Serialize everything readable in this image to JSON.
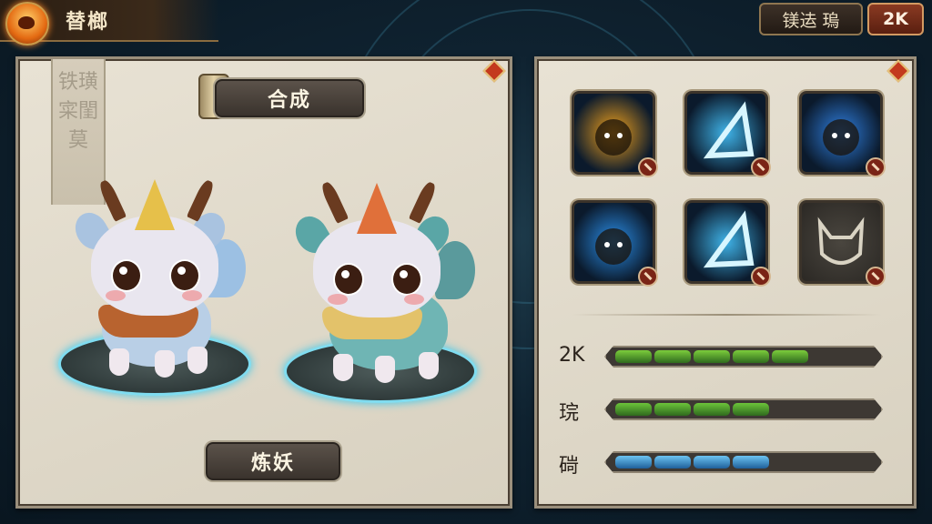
{
  "header": {
    "title": "替榔",
    "right_button": "镁迲 瑦",
    "level_badge": "2K"
  },
  "left_panel": {
    "banner_text": "铁璜寀閨莫",
    "compose_button": "合成",
    "refine_button": "炼妖",
    "creatures": [
      {
        "name": "blue-kirin",
        "body_color": "#b9cfe6",
        "mane_color": "#b8632f",
        "crest_color": "#e6c04a"
      },
      {
        "name": "teal-kirin",
        "body_color": "#6fb5b4",
        "mane_color": "#e3c26a",
        "crest_color": "#e0703a"
      }
    ]
  },
  "right_panel": {
    "skills": [
      {
        "icon": "fire-demon-icon",
        "color": "#f2a21c"
      },
      {
        "icon": "ice-shard-icon",
        "color": "#3fb3e8"
      },
      {
        "icon": "water-spirit-icon",
        "color": "#2f7fe0"
      },
      {
        "icon": "ghost-spirit-icon",
        "color": "#2a8ee8"
      },
      {
        "icon": "frost-blade-icon",
        "color": "#3fb3e8"
      },
      {
        "icon": "locked-beast-icon",
        "color": "#5a554d"
      }
    ],
    "stats": [
      {
        "label": "2K",
        "filled": 5,
        "total": 7,
        "color": "#7ccd3c"
      },
      {
        "label": "琓",
        "filled": 4,
        "total": 7,
        "color": "#6cc43a"
      },
      {
        "label": "碋",
        "filled": 4,
        "total": 7,
        "color": "#3d9fe0"
      }
    ]
  }
}
